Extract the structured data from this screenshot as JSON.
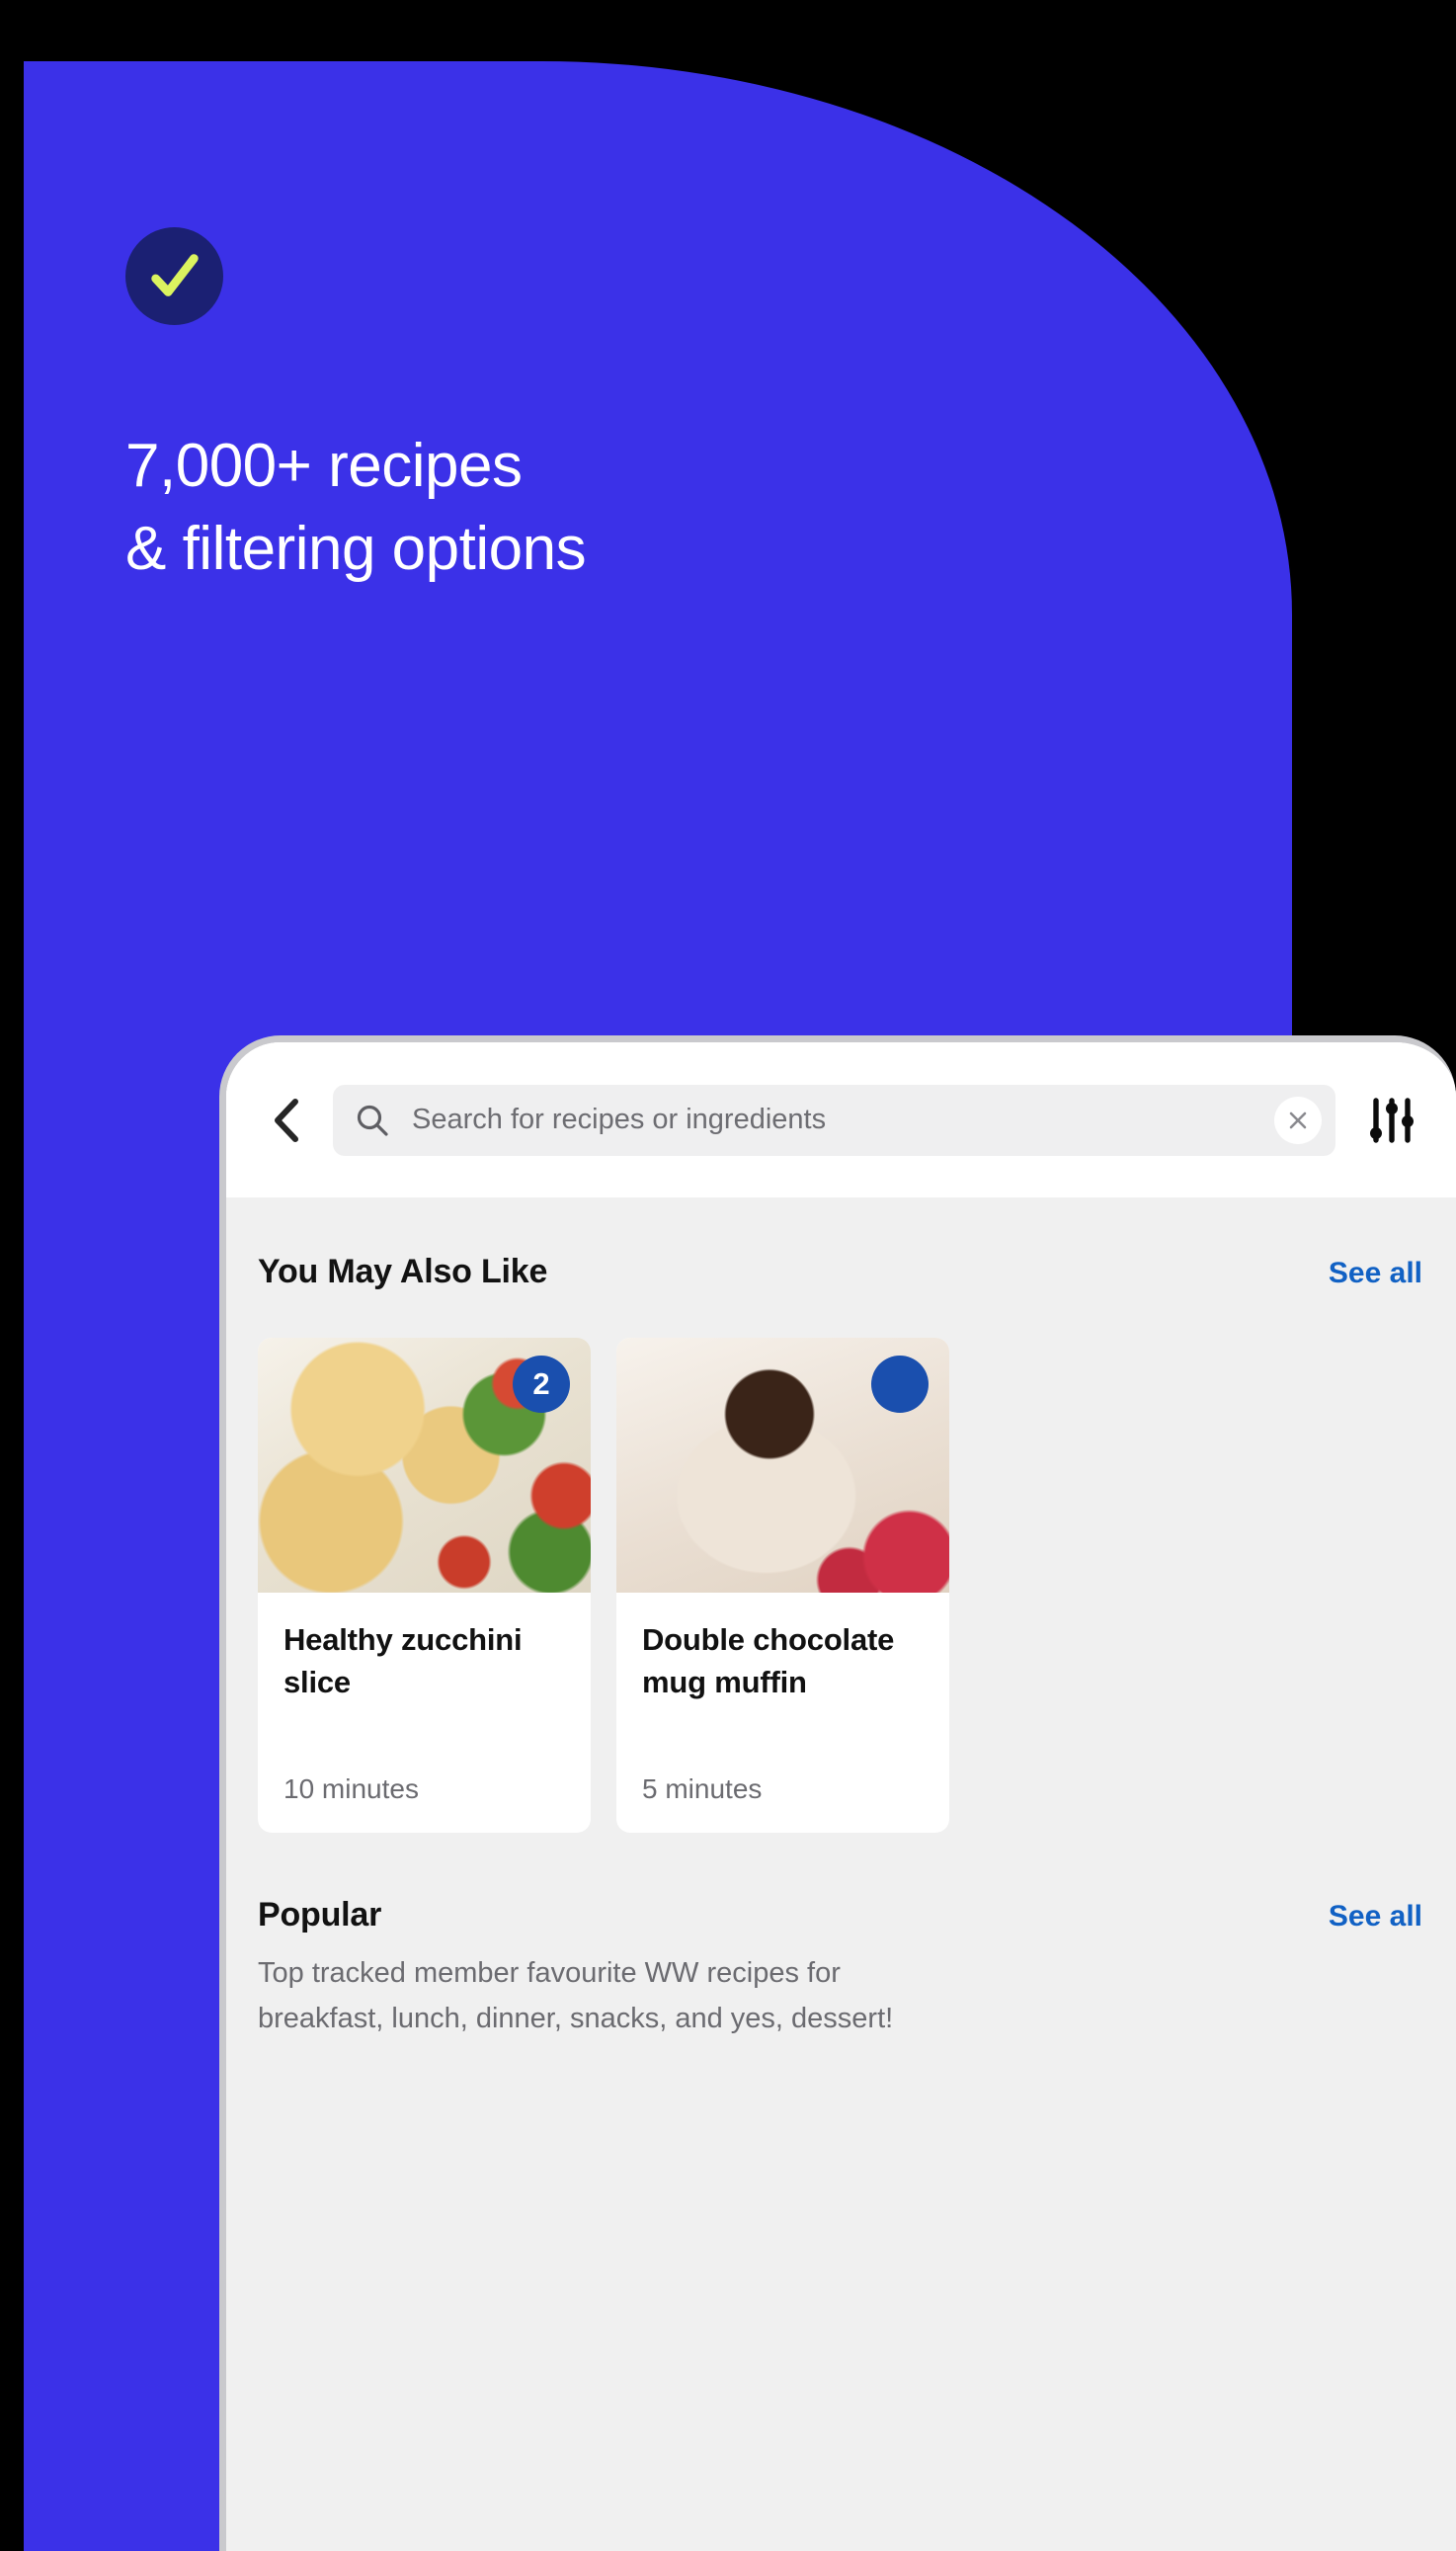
{
  "marketing": {
    "badge_icon": "check-icon",
    "headline": "7,000+ recipes\n& filtering options",
    "panel_color": "#3b31e8",
    "badge_color": "#1b2073",
    "check_color": "#dbf35f",
    "headline_color": "#ffffff"
  },
  "phone": {
    "search": {
      "back_icon": "chevron-left-icon",
      "search_icon": "search-icon",
      "placeholder": "Search for recipes or ingredients",
      "value": "",
      "clear_icon": "close-icon",
      "filter_icon": "sliders-icon"
    },
    "sections": [
      {
        "id": "you-may-also-like",
        "title": "You May Also Like",
        "see_all_label": "See all",
        "cards": [
          {
            "title": "Healthy zucchini slice",
            "points": "2",
            "time": "10 minutes",
            "photo": "zucchini-slice-photo"
          },
          {
            "title": "Double chocolate mug muffin",
            "points": "",
            "time": "5 minutes",
            "photo": "chocolate-mug-muffin-photo"
          }
        ]
      },
      {
        "id": "popular",
        "title": "Popular",
        "see_all_label": "See all",
        "description": "Top tracked member favourite WW recipes for\nbreakfast, lunch, dinner, snacks, and yes, dessert!"
      }
    ],
    "accent_link_color": "#1161c4",
    "points_badge_color": "#1a4fae",
    "content_bg": "#f0f0f0"
  }
}
